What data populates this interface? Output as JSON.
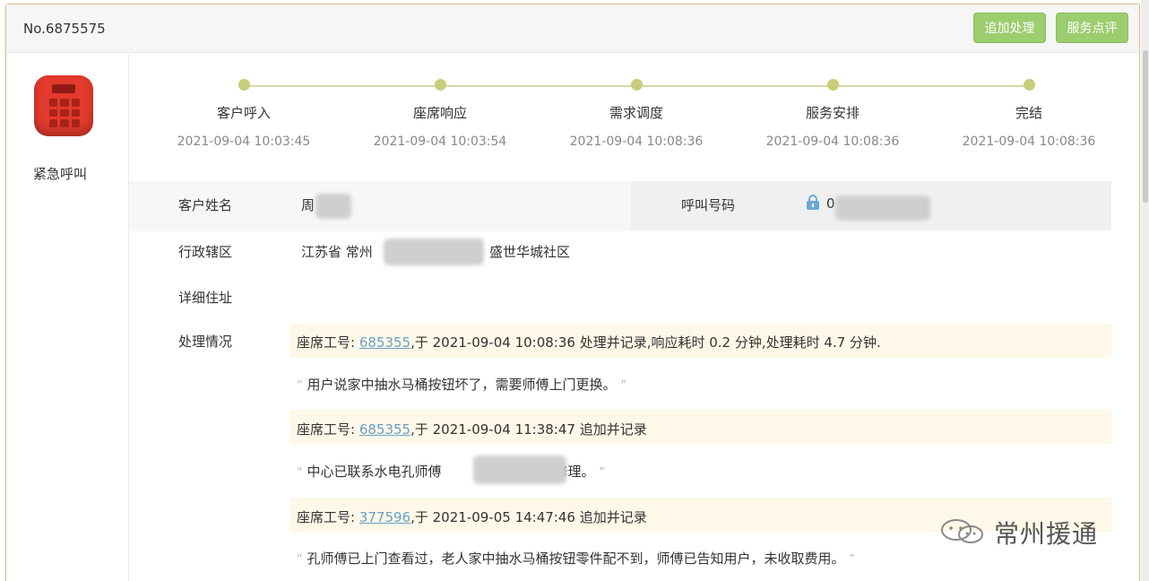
{
  "header": {
    "ticket_no": "No.6875575",
    "append_button": "追加处理",
    "review_button": "服务点评"
  },
  "call": {
    "type_label": "紧急呼叫",
    "icon": "telephone-icon"
  },
  "timeline": [
    {
      "label": "客户呼入",
      "time": "2021-09-04 10:03:45"
    },
    {
      "label": "座席响应",
      "time": "2021-09-04 10:03:54"
    },
    {
      "label": "需求调度",
      "time": "2021-09-04 10:08:36"
    },
    {
      "label": "服务安排",
      "time": "2021-09-04 10:08:36"
    },
    {
      "label": "完结",
      "time": "2021-09-04 10:08:36"
    }
  ],
  "fields": {
    "customer_name_label": "客户姓名",
    "customer_name_value": "周",
    "call_number_label": "呼叫号码",
    "call_number_value": "0",
    "district_label": "行政辖区",
    "district_prefix": "江苏省 常州",
    "district_suffix": "盛世华城社区",
    "address_label": "详细住址",
    "handling_label": "处理情况"
  },
  "logs": [
    {
      "prefix": "座席工号: ",
      "agent_id": "685355",
      "suffix": ",于 2021-09-04 10:08:36 处理并记录,响应耗时 0.2 分钟,处理耗时 4.7 分钟.",
      "note": "用户说家中抽水马桶按钮坏了，需要师傅上门更换。"
    },
    {
      "prefix": "座席工号: ",
      "agent_id": "685355",
      "suffix": ",于 2021-09-04 11:38:47 追加并记录",
      "note_a": "中心已联系水电孔师傅",
      "note_b": "上门修理。"
    },
    {
      "prefix": "座席工号: ",
      "agent_id": "377596",
      "suffix": ",于 2021-09-05 14:47:46 追加并记录",
      "note": "孔师傅已上门查看过，老人家中抽水马桶按钮零件配不到，师傅已告知用户，未收取费用。"
    }
  ],
  "quote_open": "“",
  "quote_close": "”",
  "watermark": {
    "text": "常州援通",
    "icon": "wechat-icon"
  },
  "colors": {
    "button_green": "#9ccd6e",
    "timeline_dot": "#c7cd7a",
    "link_blue": "#6a9fc7",
    "phone_red": "#e33a2c",
    "log_band": "#fdf8e8"
  }
}
